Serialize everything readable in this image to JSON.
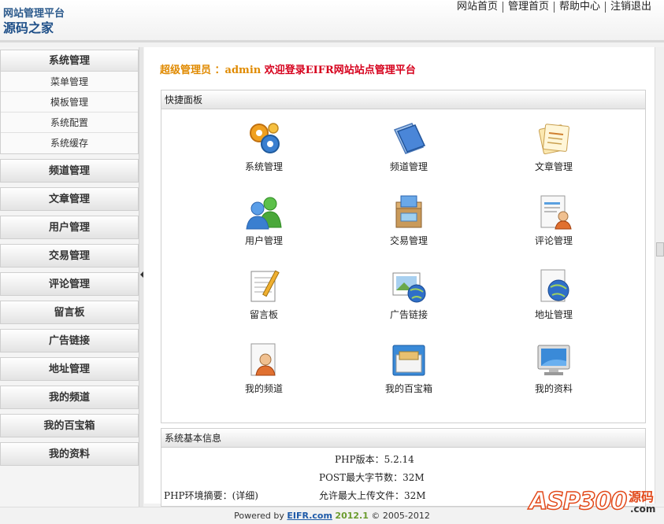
{
  "header": {
    "brand_line1": "网站管理平台",
    "brand_line2": "源码之家",
    "nav": [
      "网站首页",
      "管理首页",
      "帮助中心",
      "注销退出"
    ]
  },
  "sidebar": {
    "group": {
      "title": "系统管理",
      "items": [
        "菜单管理",
        "模板管理",
        "系统配置",
        "系统缓存"
      ]
    },
    "buttons": [
      "频道管理",
      "文章管理",
      "用户管理",
      "交易管理",
      "评论管理",
      "留言板",
      "广告链接",
      "地址管理",
      "我的频道",
      "我的百宝箱",
      "我的资料"
    ]
  },
  "welcome": {
    "role": "超级管理员",
    "user": "：admin",
    "message": "欢迎登录EIFR网站站点管理平台"
  },
  "quick_panel": {
    "title": "快捷面板",
    "tiles": [
      {
        "label": "系统管理",
        "icon": "gears-icon"
      },
      {
        "label": "频道管理",
        "icon": "folders-icon"
      },
      {
        "label": "文章管理",
        "icon": "notes-icon"
      },
      {
        "label": "用户管理",
        "icon": "users-icon"
      },
      {
        "label": "交易管理",
        "icon": "package-icon"
      },
      {
        "label": "评论管理",
        "icon": "document-user-icon"
      },
      {
        "label": "留言板",
        "icon": "notepad-icon"
      },
      {
        "label": "广告链接",
        "icon": "image-globe-icon"
      },
      {
        "label": "地址管理",
        "icon": "document-globe-icon"
      },
      {
        "label": "我的频道",
        "icon": "document-person-icon"
      },
      {
        "label": "我的百宝箱",
        "icon": "file-box-icon"
      },
      {
        "label": "我的资料",
        "icon": "monitor-icon"
      }
    ]
  },
  "system_info": {
    "title": "系统基本信息",
    "php_summary": "PHP环境摘要：(详细)",
    "php_version": "PHP版本：5.2.14",
    "post_max": "POST最大字节数：32M",
    "upload_max": "允许最大上传文件：32M"
  },
  "footer": {
    "powered": "Powered by",
    "link": "EIFR.com",
    "version": "2012.1",
    "copyright": "© 2005-2012"
  },
  "watermark": {
    "asp": "ASP300",
    "cn": "源码",
    "com": ".com"
  },
  "colors": {
    "role": "#e08a00",
    "message": "#d6001c",
    "link": "#1e5aa8",
    "version": "#6a9b2e"
  }
}
